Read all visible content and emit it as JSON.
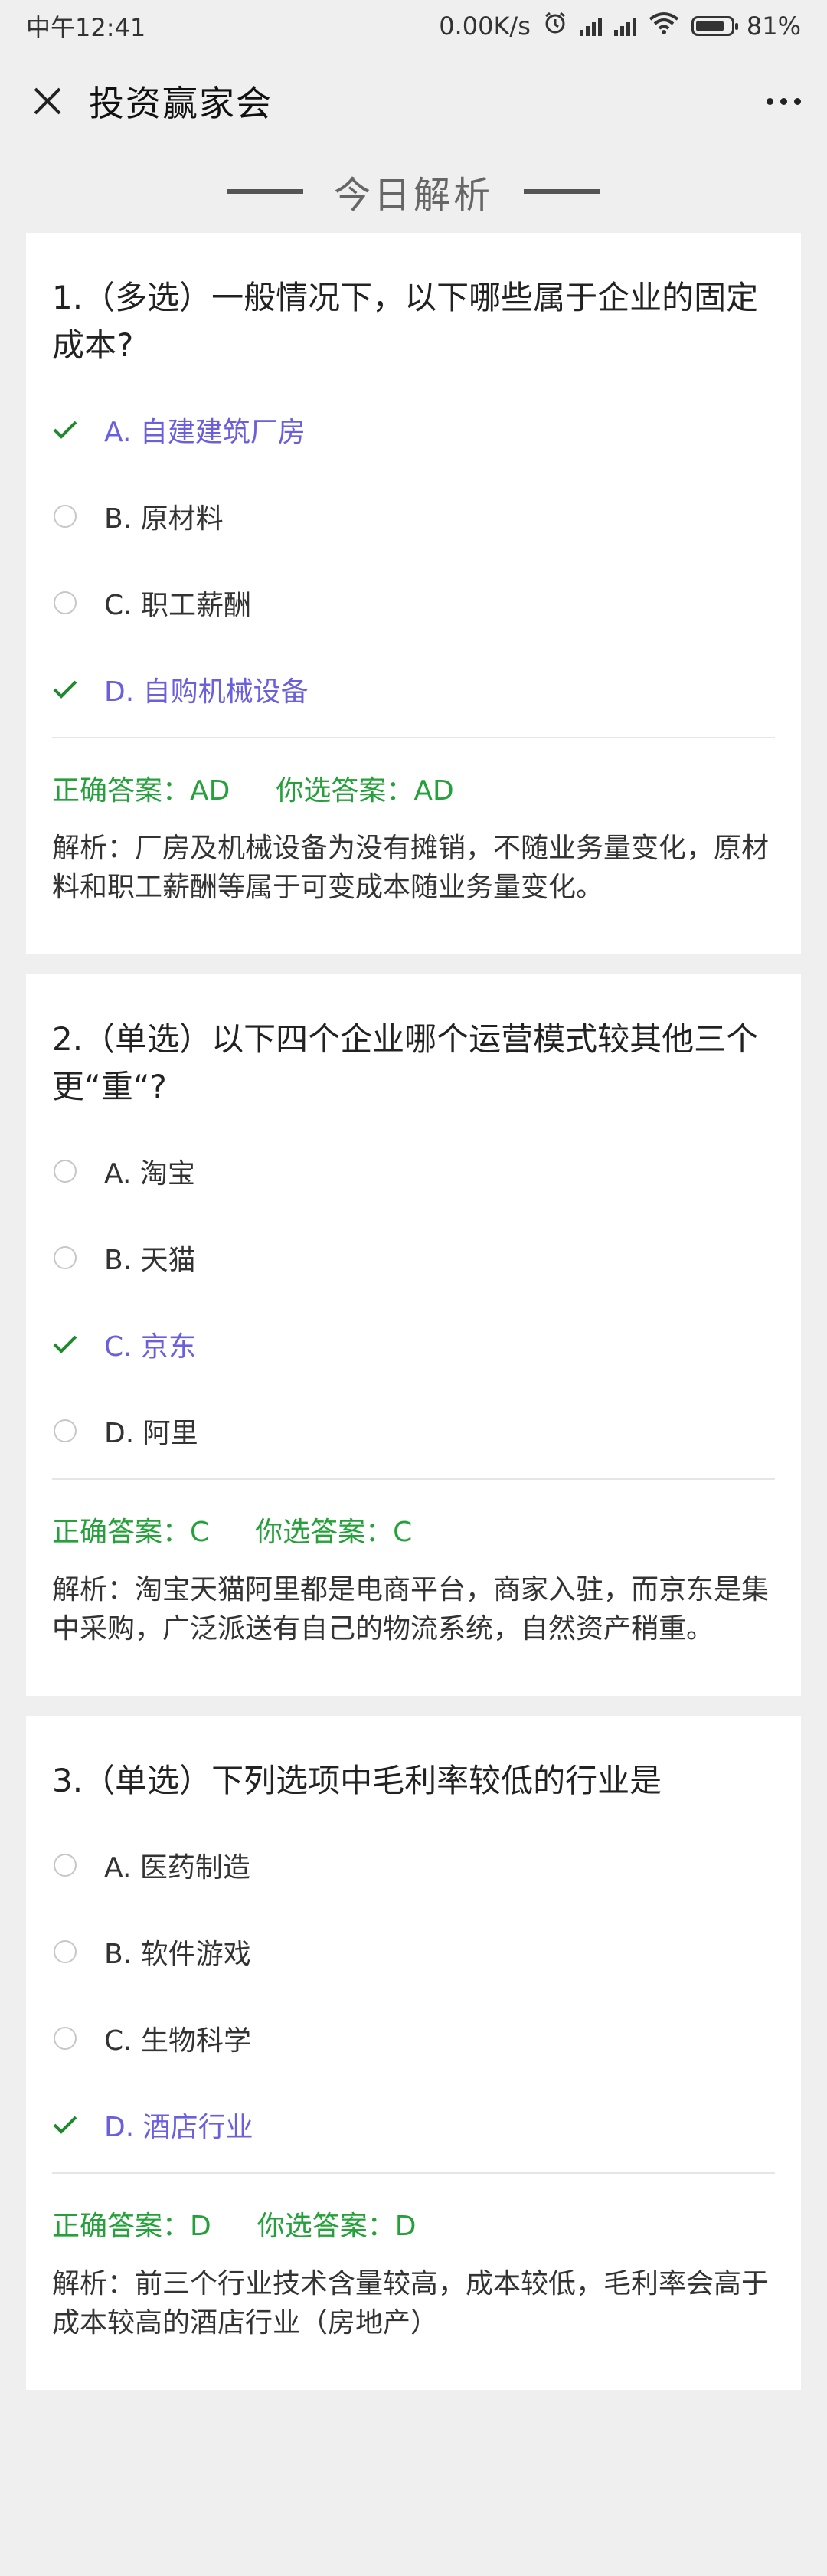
{
  "status": {
    "time": "中午12:41",
    "speed": "0.00K/s",
    "battery": "81%",
    "battery_level": 0.81
  },
  "nav": {
    "title": "投资赢家会"
  },
  "section": {
    "title": "今日解析"
  },
  "colors": {
    "correct": "#25a03a",
    "chosen": "#6a5fdc",
    "check": "#1f8a2d"
  },
  "questions": [
    {
      "title": "1.（多选）一般情况下，以下哪些属于企业的固定成本?",
      "options": [
        {
          "label": "A. 自建建筑厂房",
          "chosen": true
        },
        {
          "label": "B. 原材料",
          "chosen": false
        },
        {
          "label": "C. 职工薪酬",
          "chosen": false
        },
        {
          "label": "D. 自购机械设备",
          "chosen": true
        }
      ],
      "correct": "正确答案：AD",
      "yours": "你选答案：AD",
      "explain": "解析：厂房及机械设备为没有摊销，不随业务量变化，原材料和职工薪酬等属于可变成本随业务量变化。"
    },
    {
      "title": "2.（单选）以下四个企业哪个运营模式较其他三个更“重“?",
      "options": [
        {
          "label": "A. 淘宝",
          "chosen": false
        },
        {
          "label": "B. 天猫",
          "chosen": false
        },
        {
          "label": "C. 京东",
          "chosen": true
        },
        {
          "label": "D. 阿里",
          "chosen": false
        }
      ],
      "correct": "正确答案：C",
      "yours": "你选答案：C",
      "explain": "解析：淘宝天猫阿里都是电商平台，商家入驻，而京东是集中采购，广泛派送有自己的物流系统，自然资产稍重。"
    },
    {
      "title": "3.（单选）下列选项中毛利率较低的行业是",
      "options": [
        {
          "label": "A. 医药制造",
          "chosen": false
        },
        {
          "label": "B. 软件游戏",
          "chosen": false
        },
        {
          "label": "C. 生物科学",
          "chosen": false
        },
        {
          "label": "D. 酒店行业",
          "chosen": true
        }
      ],
      "correct": "正确答案：D",
      "yours": "你选答案：D",
      "explain": "解析：前三个行业技术含量较高，成本较低，毛利率会高于成本较高的酒店行业（房地产）"
    }
  ]
}
